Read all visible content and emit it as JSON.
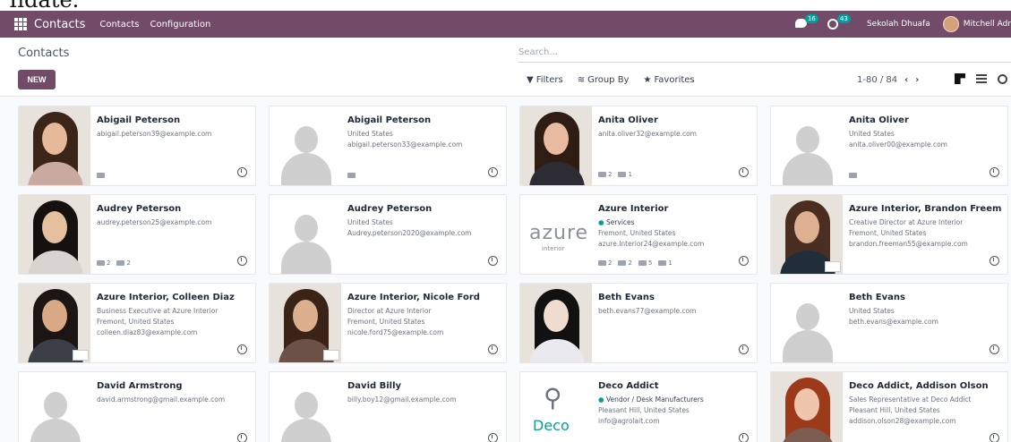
{
  "top_strip_text": "Ildate.",
  "navbar": {
    "app_name": "Contacts",
    "menu": [
      "Contacts",
      "Configuration"
    ],
    "messages_count": "16",
    "activities_count": "43",
    "company": "Sekolah Dhuafa",
    "user": "Mitchell Adr"
  },
  "control": {
    "breadcrumb": "Contacts",
    "new_label": "NEW",
    "search_placeholder": "Search...",
    "filters_label": "Filters",
    "groupby_label": "Group By",
    "favorites_label": "Favorites",
    "pager": "1-80 / 84"
  },
  "colors": {
    "brand": "#714b67",
    "accent": "#00a09d"
  },
  "cards": [
    {
      "name": "Abigail Peterson",
      "lines": [
        "abigail.peterson39@example.com"
      ],
      "footer": [
        ""
      ]
    },
    {
      "name": "Abigail Peterson",
      "lines": [
        "United States",
        "abigail.peterson33@example.com"
      ],
      "footer": [
        ""
      ]
    },
    {
      "name": "Anita Oliver",
      "lines": [
        "anita.oliver32@example.com"
      ],
      "footer": [
        "2",
        "1"
      ]
    },
    {
      "name": "Anita Oliver",
      "lines": [
        "United States",
        "anita.oliver00@example.com"
      ],
      "footer": [
        ""
      ]
    },
    {
      "name": "Audrey Peterson",
      "lines": [
        "audrey.peterson25@example.com"
      ],
      "footer": [
        "2",
        "2"
      ]
    },
    {
      "name": "Audrey Peterson",
      "lines": [
        "United States",
        "Audrey.peterson2020@example.com"
      ],
      "footer": []
    },
    {
      "name": "Azure Interior",
      "tag": "Services",
      "lines": [
        "Fremont, United States",
        "azure.Interior24@example.com"
      ],
      "footer": [
        "2",
        "2",
        "5",
        "1"
      ]
    },
    {
      "name": "Azure Interior, Brandon Freeman",
      "lines": [
        "Creative Director at Azure Interior",
        "Fremont, United States",
        "brandon.freeman55@example.com"
      ],
      "footer": []
    },
    {
      "name": "Azure Interior, Colleen Diaz",
      "lines": [
        "Business Executive at Azure Interior",
        "Fremont, United States",
        "colleen.diaz83@example.com"
      ],
      "footer": []
    },
    {
      "name": "Azure Interior, Nicole Ford",
      "lines": [
        "Director at Azure Interior",
        "Fremont, United States",
        "nicole.ford75@example.com"
      ],
      "footer": []
    },
    {
      "name": "Beth Evans",
      "lines": [
        "beth.evans77@example.com"
      ],
      "footer": []
    },
    {
      "name": "Beth Evans",
      "lines": [
        "United States",
        "beth.evans@example.com"
      ],
      "footer": []
    },
    {
      "name": "David Armstrong",
      "lines": [
        "david.armstrong@gmail.example.com"
      ],
      "footer": []
    },
    {
      "name": "David Billy",
      "lines": [
        "billy.boy12@gmail.example.com"
      ],
      "footer": []
    },
    {
      "name": "Deco Addict",
      "tag": "Vendor / Desk Manufacturers",
      "lines": [
        "Pleasant Hill, United States",
        "info@agrolait.com"
      ],
      "footer": []
    },
    {
      "name": "Deco Addict, Addison Olson",
      "lines": [
        "Sales Representative at Deco Addict",
        "Pleasant Hill, United States",
        "addison.olson28@example.com"
      ],
      "footer": []
    }
  ],
  "logos": {
    "azure_word": "azure",
    "azure_sub": "interior",
    "deco_word": "Deco"
  }
}
